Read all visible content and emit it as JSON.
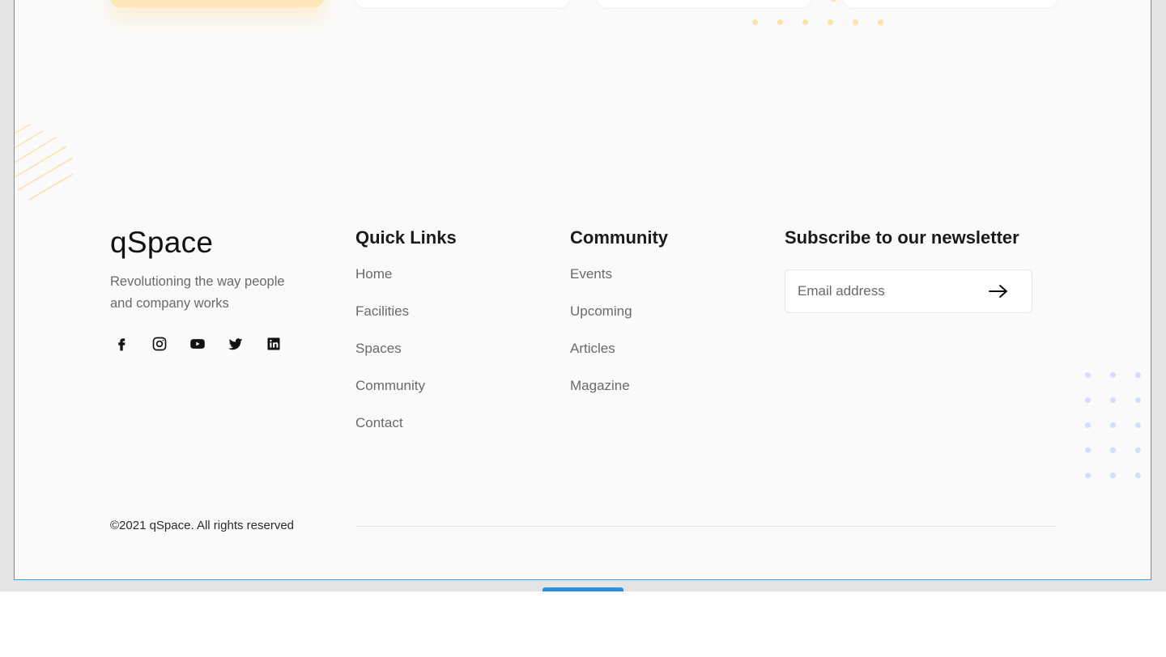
{
  "brand": {
    "logo": "qSpace",
    "tagline": "Revolutioning the way people and company works"
  },
  "socials": [
    {
      "name": "facebook"
    },
    {
      "name": "instagram"
    },
    {
      "name": "youtube"
    },
    {
      "name": "twitter"
    },
    {
      "name": "linkedin"
    }
  ],
  "quick_links": {
    "title": "Quick Links",
    "items": [
      "Home",
      "Facilities",
      "Spaces",
      "Community",
      "Contact"
    ]
  },
  "community": {
    "title": "Community",
    "items": [
      "Events",
      "Upcoming",
      "Articles",
      "Magazine"
    ]
  },
  "newsletter": {
    "title": "Subscribe to our newsletter",
    "placeholder": "Email address",
    "value": ""
  },
  "copyright": "©2021 qSpace. All rights reserved",
  "colors": {
    "accent_blue": "#2a8fe0",
    "yellow_dots": "#ffe1ad",
    "blue_dots": "#d5def8",
    "hatch": "#ffe1ad"
  }
}
